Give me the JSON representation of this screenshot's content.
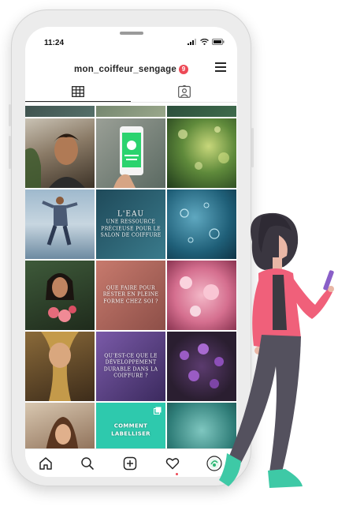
{
  "status_bar": {
    "time": "11:24"
  },
  "header": {
    "username": "mon_coiffeur_sengage",
    "notification_count": "9"
  },
  "tabs": [
    {
      "name": "grid-view",
      "icon": "grid-icon",
      "active": true
    },
    {
      "name": "tagged-view",
      "icon": "tagged-person-icon",
      "active": false
    }
  ],
  "posts": [
    {
      "icon": "post-photo",
      "caption": ""
    },
    {
      "icon": "post-photo",
      "caption": ""
    },
    {
      "icon": "post-photo",
      "caption": ""
    },
    {
      "icon": "post-photo",
      "caption": ""
    },
    {
      "icon": "post-phone-app",
      "caption": ""
    },
    {
      "icon": "post-photo",
      "caption": ""
    },
    {
      "icon": "post-photo",
      "caption": ""
    },
    {
      "icon": "post-text",
      "title": "L'EAU",
      "caption": "UNE RESSOURCE PRÉCIEUSE POUR LE SALON DE COIFFURE"
    },
    {
      "icon": "post-photo",
      "caption": ""
    },
    {
      "icon": "post-photo",
      "caption": ""
    },
    {
      "icon": "post-text",
      "title": "",
      "caption": "QUE FAIRE POUR RESTER EN PLEINE FORME CHEZ SOI ?"
    },
    {
      "icon": "post-photo",
      "caption": ""
    },
    {
      "icon": "post-photo",
      "caption": ""
    },
    {
      "icon": "post-text",
      "title": "",
      "caption": "QU'EST-CE QUE LE DÉVELOPPEMENT DURABLE DANS LA COIFFURE ?"
    },
    {
      "icon": "post-photo",
      "caption": ""
    },
    {
      "icon": "post-photo",
      "caption": ""
    },
    {
      "icon": "post-text",
      "title": "",
      "caption": "COMMENT LABELLISER"
    },
    {
      "icon": "post-photo",
      "caption": ""
    }
  ],
  "bottom_nav": [
    {
      "name": "home",
      "icon": "home-icon"
    },
    {
      "name": "search",
      "icon": "search-icon"
    },
    {
      "name": "new-post",
      "icon": "plus-square-icon"
    },
    {
      "name": "activity",
      "icon": "heart-icon"
    },
    {
      "name": "profile",
      "icon": "profile-avatar-icon"
    }
  ],
  "colors": {
    "badge": "#ed4956",
    "teal_post": "#2ec9ad",
    "woman_top": "#f0607a",
    "woman_pants": "#54515e",
    "woman_shoes": "#3ec9a6",
    "woman_hair": "#3a3640"
  }
}
